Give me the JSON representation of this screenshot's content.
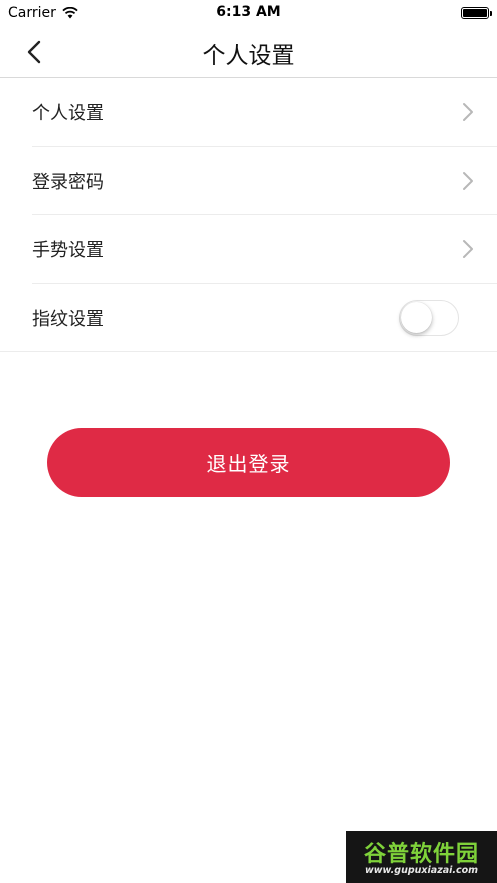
{
  "status_bar": {
    "carrier": "Carrier",
    "time": "6:13 AM"
  },
  "nav": {
    "title": "个人设置"
  },
  "settings": {
    "items": [
      {
        "label": "个人设置",
        "control": "chevron"
      },
      {
        "label": "登录密码",
        "control": "chevron"
      },
      {
        "label": "手势设置",
        "control": "chevron"
      },
      {
        "label": "指纹设置",
        "control": "toggle",
        "toggle_on": false
      }
    ]
  },
  "logout": {
    "label": "退出登录"
  },
  "colors": {
    "accent": "#df2a45",
    "separator": "#ececec"
  },
  "watermark": {
    "brand": "谷普软件园",
    "url": "www.gupuxiazai.com"
  }
}
